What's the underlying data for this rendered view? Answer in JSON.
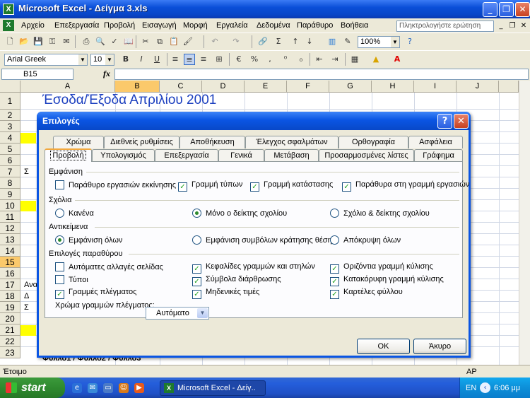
{
  "window": {
    "title": "Microsoft Excel - Δείγμα 3.xls",
    "app_icon": "X"
  },
  "menu": {
    "items": [
      "Αρχείο",
      "Επεξεργασία",
      "Προβολή",
      "Εισαγωγή",
      "Μορφή",
      "Εργαλεία",
      "Δεδομένα",
      "Παράθυρο",
      "Βοήθεια"
    ],
    "ask_placeholder": "Πληκτρολογήστε ερώτηση"
  },
  "toolbar": {
    "zoom": "100%"
  },
  "format_toolbar": {
    "font": "Arial Greek",
    "size": "10"
  },
  "formula_bar": {
    "name_box": "B15",
    "fx": "fx"
  },
  "sheet": {
    "columns": [
      "A",
      "B",
      "C",
      "D",
      "E",
      "F",
      "G",
      "H",
      "I",
      "J"
    ],
    "selected_column": "B",
    "rows": [
      "1",
      "2",
      "3",
      "4",
      "5",
      "6",
      "7",
      "8",
      "9",
      "10",
      "11",
      "12",
      "13",
      "14",
      "15",
      "16",
      "17",
      "18",
      "19",
      "20",
      "21",
      "22",
      "23"
    ],
    "selected_row": "15",
    "title": "Έσοδα/Έξοδα Απριλίου 2001",
    "fragments": {
      "r7": "Σ",
      "r17": "Ανα",
      "r18": "Δ",
      "r19": "Σ"
    },
    "sheet_tabs": "Φύλλο1 / Φύλλο2 / Φύλλο3",
    "highlight_color": "#ffff00"
  },
  "status": {
    "left": "Έτοιμο",
    "right": "ΑΡ"
  },
  "taskbar": {
    "start": "start",
    "task": "Microsoft Excel - Δείγ..",
    "lang": "EN",
    "time": "6:06 μμ"
  },
  "dialog": {
    "title": "Επιλογές",
    "tabs_row1": [
      "Χρώμα",
      "Διεθνείς ρυθμίσεις",
      "Αποθήκευση",
      "Έλεγχος σφαλμάτων",
      "Ορθογραφία",
      "Ασφάλεια"
    ],
    "tabs_row2": [
      "Προβολή",
      "Υπολογισμός",
      "Επεξεργασία",
      "Γενικά",
      "Μετάβαση",
      "Προσαρμοσμένες λίστες",
      "Γράφημα"
    ],
    "active_tab": "Προβολή",
    "show": {
      "label": "Εμφάνιση",
      "startup_task_pane": "Παράθυρο εργασιών εκκίνησης",
      "formula_bar": "Γραμμή τύπων",
      "status_bar": "Γραμμή κατάστασης",
      "windows_in_taskbar": "Παράθυρα στη γραμμή εργασιών"
    },
    "comments": {
      "label": "Σχόλια",
      "none": "Κανένα",
      "indicator_only": "Μόνο ο δείκτης σχολίου",
      "comment_and_indicator": "Σχόλιο & δείκτης σχολίου"
    },
    "objects": {
      "label": "Αντικείμενα",
      "show_all": "Εμφάνιση όλων",
      "show_placeholders": "Εμφάνιση συμβόλων κράτησης θέσης",
      "hide_all": "Απόκρυψη όλων"
    },
    "window_options": {
      "label": "Επιλογές παραθύρου",
      "page_breaks": "Αυτόματες αλλαγές σελίδας",
      "formulas": "Τύποι",
      "gridlines": "Γραμμές πλέγματος",
      "row_col_headers": "Κεφαλίδες γραμμών και στηλών",
      "outline_symbols": "Σύμβολα διάρθρωσης",
      "zero_values": "Μηδενικές τιμές",
      "horizontal_scroll": "Οριζόντια γραμμή κύλισης",
      "vertical_scroll": "Κατακόρυφη γραμμή κύλισης",
      "sheet_tabs": "Καρτέλες φύλλου"
    },
    "gridline_color_label": "Χρώμα γραμμών πλέγματος:",
    "gridline_color_value": "Αυτόματο",
    "ok": "OK",
    "cancel": "Άκυρο"
  }
}
